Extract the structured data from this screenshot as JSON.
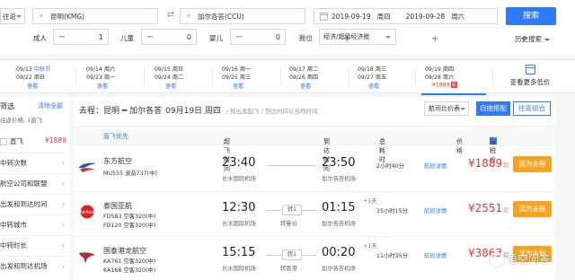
{
  "search": {
    "trip_type": "往返",
    "from_city": "昆明(KMG)",
    "to_city": "加尔各答(CCU)",
    "depart_date": "2019-09-19",
    "depart_weekday": "周四",
    "return_date": "2019-09-28",
    "return_weekday": "周六",
    "search_label": "搜索",
    "adult_label": "成人",
    "adult_count": "1",
    "child_label": "儿童",
    "child_count": "0",
    "infant_label": "婴儿",
    "infant_count": "0",
    "cabin_label": "舱位",
    "cabin_value": "经济/超级经济舱",
    "history_label": "历史搜索",
    "minus": "−",
    "plus": "+"
  },
  "date_strip": {
    "cells": [
      {
        "l1": "09/13",
        "l1b": "中秋节",
        "l2": "09/22",
        "l2b": "周日",
        "l3": "查看"
      },
      {
        "l1": "09/14",
        "l1b": "周六",
        "l2": "09/23",
        "l2b": "周一",
        "l3": "查看"
      },
      {
        "l1": "09/15",
        "l1b": "周日",
        "l2": "09/24",
        "l2b": "周二",
        "l3": "查看"
      },
      {
        "l1": "09/16",
        "l1b": "周一",
        "l2": "09/25",
        "l2b": "周三",
        "l3": "查看"
      },
      {
        "l1": "09/17",
        "l1b": "周二",
        "l2": "09/26",
        "l2b": "周四",
        "l3": "查看"
      },
      {
        "l1": "09/18",
        "l1b": "周三",
        "l2": "09/27",
        "l2b": "周五",
        "l3": "查看"
      },
      {
        "l1": "09/19",
        "l1b": "周四",
        "l2": "09/28",
        "l2b": "周六",
        "l3": "¥1889",
        "tag": "起"
      }
    ],
    "cheap_label": "查看更多低价"
  },
  "filters": {
    "title": "筛选",
    "clear": "清除全部",
    "summary": "往返价格, 1直飞",
    "direct_label": "直飞",
    "direct_price": "¥1889",
    "rows": [
      "中转次数",
      "航空公司和联盟",
      "出发和到达时间",
      "中转城市",
      "中转时长",
      "出发和到达机场"
    ]
  },
  "results": {
    "route_prefix": "去程：",
    "route": "昆明 ━ 加尔各答",
    "date": "09月19日 周四",
    "meta": "/ 按出发起飞 / 到达时间以当地时间",
    "sort": "航司比价表",
    "tab_free": "自由搭配",
    "tab_combo": "往返组合",
    "headers": {
      "direct_first": "直飞优先",
      "depart": "起飞时间",
      "arrive": "到达时间",
      "duration": "总耗时",
      "price": "价格",
      "tax": "含税价",
      "sort_arrow": "⇅"
    },
    "flights": [
      {
        "airline": "东方航空",
        "fno1": "MU555 波音737(中)",
        "fno2": "",
        "dep_time": "23:40",
        "dep_airport": "长水国际机场",
        "stop": "",
        "via": "",
        "arr_time": "23:50",
        "arr_airport": "加尔各答机场",
        "next_day": "",
        "duration": "2小时40分",
        "detail": "航班详情",
        "price": "¥1889",
        "price_suffix": "起",
        "book": "选为去程",
        "logo": "china-eastern"
      },
      {
        "airline": "泰国亚航",
        "fno1": "FD583 空客320(中)",
        "fno2": "FD120 空客320(中)",
        "dep_time": "12:30",
        "dep_airport": "长水国际机场",
        "stop": "转1",
        "via": "转曼谷",
        "arr_time": "01:15",
        "arr_airport": "加尔各答机场",
        "next_day": "+1天",
        "duration": "15小时15分",
        "detail": "航班详情",
        "price": "¥2551",
        "price_suffix": "起",
        "book": "选为去程",
        "logo": "airasia"
      },
      {
        "airline": "国泰港龙航空",
        "fno1": "KA761 空客320(中)",
        "fno2": "KA168 空客320(中)",
        "dep_time": "15:15",
        "dep_airport": "长水国际机场",
        "stop": "转1",
        "via": "转香港",
        "arr_time": "00:20",
        "arr_airport": "加尔各答机场",
        "next_day": "+1天",
        "duration": "11小时35分",
        "detail": "航班详情",
        "price": "¥3863",
        "price_suffix": "起",
        "book": "选为去程",
        "logo": "cathay-dragon"
      }
    ]
  },
  "watermark": "悟空问答",
  "colors": {
    "accent": "#2f7bf5",
    "price": "#e8352f",
    "book_button": "#f5a321"
  }
}
